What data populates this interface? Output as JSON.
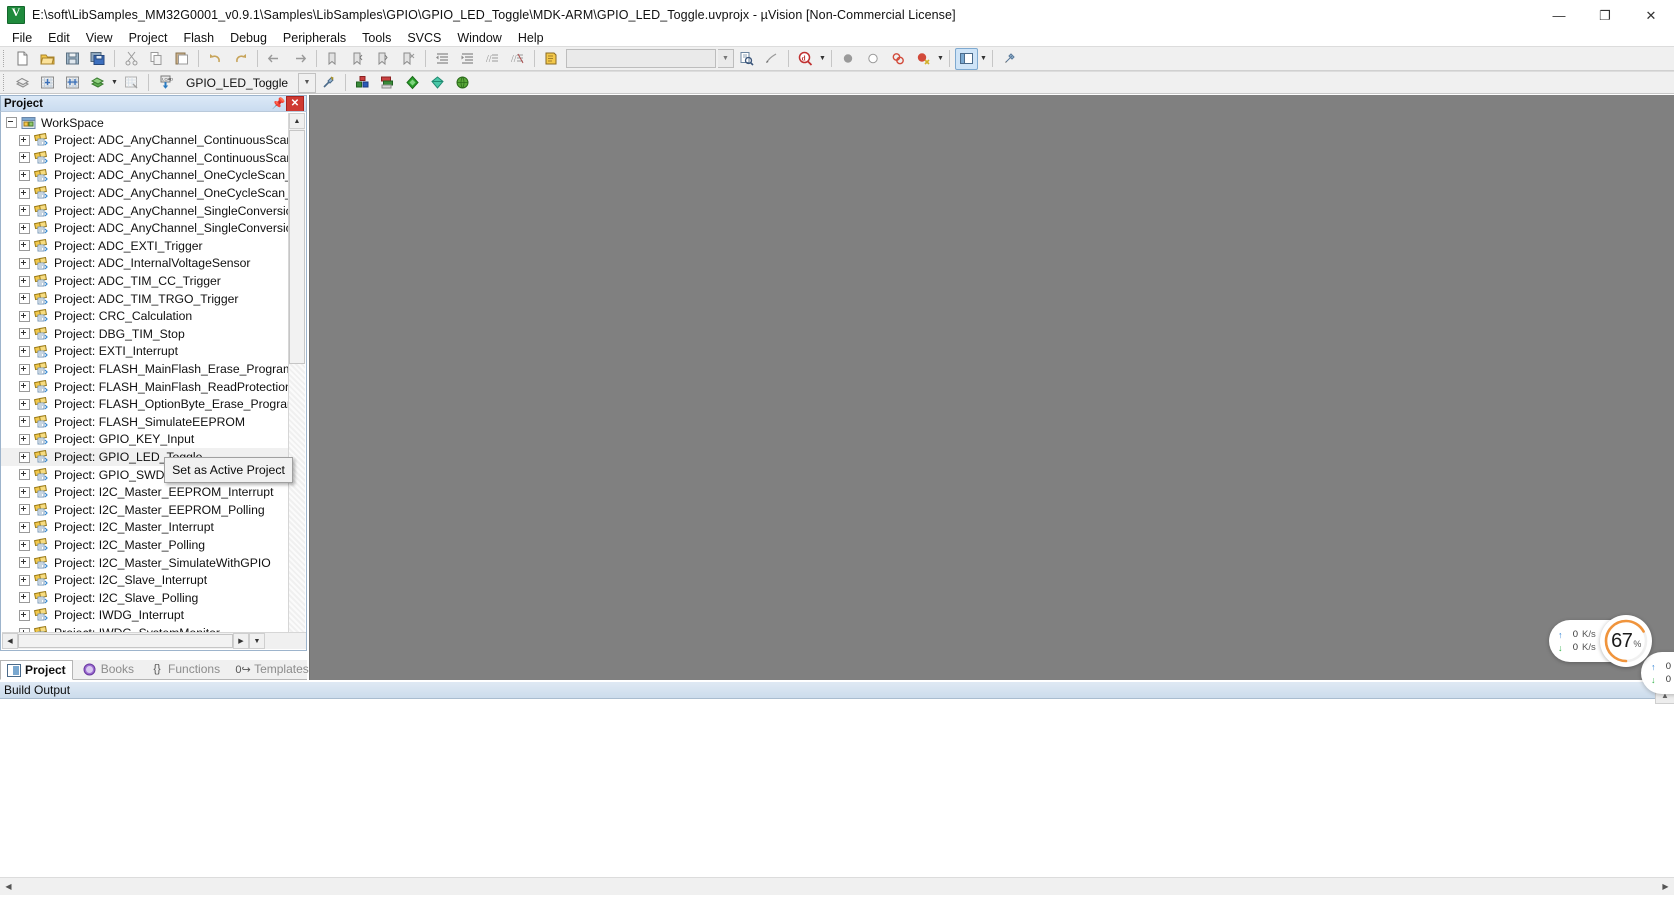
{
  "window": {
    "title": "E:\\soft\\LibSamples_MM32G0001_v0.9.1\\Samples\\LibSamples\\GPIO\\GPIO_LED_Toggle\\MDK-ARM\\GPIO_LED_Toggle.uvprojx - µVision  [Non-Commercial License]",
    "app_icon": "uvision-icon",
    "minimize": "—",
    "restore": "❐",
    "close": "✕"
  },
  "menubar": {
    "items": [
      {
        "label": "File"
      },
      {
        "label": "Edit"
      },
      {
        "label": "View"
      },
      {
        "label": "Project"
      },
      {
        "label": "Flash"
      },
      {
        "label": "Debug"
      },
      {
        "label": "Peripherals"
      },
      {
        "label": "Tools"
      },
      {
        "label": "SVCS"
      },
      {
        "label": "Window"
      },
      {
        "label": "Help"
      }
    ]
  },
  "toolbar_main": {
    "find_box_value": "",
    "find_box_placeholder": "",
    "buttons": [
      {
        "name": "new-file-icon",
        "tip": "New"
      },
      {
        "name": "open-file-icon",
        "tip": "Open"
      },
      {
        "name": "save-icon",
        "tip": "Save"
      },
      {
        "name": "save-all-icon",
        "tip": "Save All"
      },
      {
        "name": "cut-icon",
        "tip": "Cut"
      },
      {
        "name": "copy-icon",
        "tip": "Copy"
      },
      {
        "name": "paste-icon",
        "tip": "Paste"
      },
      {
        "name": "undo-icon",
        "tip": "Undo"
      },
      {
        "name": "redo-icon",
        "tip": "Redo"
      },
      {
        "name": "navigate-back-icon",
        "tip": "Back"
      },
      {
        "name": "navigate-forward-icon",
        "tip": "Forward"
      },
      {
        "name": "bookmark-toggle-icon",
        "tip": "Insert/Remove Bookmark"
      },
      {
        "name": "bookmark-prev-icon",
        "tip": "Previous Bookmark"
      },
      {
        "name": "bookmark-next-icon",
        "tip": "Next Bookmark"
      },
      {
        "name": "bookmark-clear-icon",
        "tip": "Clear Bookmarks"
      },
      {
        "name": "indent-icon",
        "tip": "Indent"
      },
      {
        "name": "outdent-icon",
        "tip": "Outdent"
      },
      {
        "name": "comment-icon",
        "tip": "Comment"
      },
      {
        "name": "uncomment-icon",
        "tip": "Uncomment"
      },
      {
        "name": "open-document-icon",
        "tip": "Open Document"
      },
      {
        "name": "find-in-files-icon",
        "tip": "Find in Files"
      },
      {
        "name": "incremental-find-icon",
        "tip": "Incremental Find"
      },
      {
        "name": "debug-session-icon",
        "tip": "Start/Stop Debug Session"
      },
      {
        "name": "breakpoint-icon",
        "tip": "Insert/Remove Breakpoint"
      },
      {
        "name": "disable-breakpoint-icon",
        "tip": "Disable Breakpoint"
      },
      {
        "name": "disable-all-breakpoints-icon",
        "tip": "Disable All Breakpoints"
      },
      {
        "name": "kill-all-breakpoints-icon",
        "tip": "Kill All Breakpoints"
      },
      {
        "name": "project-window-icon",
        "tip": "Project Window"
      }
    ]
  },
  "toolbar_build": {
    "project_name": "GPIO_LED_Toggle",
    "buttons": [
      {
        "name": "translate-icon",
        "tip": "Translate"
      },
      {
        "name": "build-icon",
        "tip": "Build"
      },
      {
        "name": "rebuild-icon",
        "tip": "Rebuild"
      },
      {
        "name": "batch-build-icon",
        "tip": "Batch Build"
      },
      {
        "name": "stop-build-icon",
        "tip": "Stop Build"
      },
      {
        "name": "download-icon",
        "tip": "Download"
      },
      {
        "name": "target-options-icon",
        "tip": "Options for Target"
      },
      {
        "name": "manage-project-items-icon",
        "tip": "Manage Project Items"
      },
      {
        "name": "manage-run-time-env-icon",
        "tip": "Manage Run-Time Environment"
      },
      {
        "name": "select-software-packs-icon",
        "tip": "Select Software Packs"
      },
      {
        "name": "pack-installer-icon",
        "tip": "Pack Installer"
      }
    ]
  },
  "project_panel": {
    "title": "Project",
    "pin_icon": "pin-icon",
    "close_icon": "close-icon",
    "root": {
      "label": "WorkSpace",
      "icon": "workspace-icon"
    },
    "items": [
      {
        "label": "Project: ADC_AnyChannel_ContinuousScan_Interrupt"
      },
      {
        "label": "Project: ADC_AnyChannel_ContinuousScan_Polling"
      },
      {
        "label": "Project: ADC_AnyChannel_OneCycleScan_Interrupt"
      },
      {
        "label": "Project: ADC_AnyChannel_OneCycleScan_Polling"
      },
      {
        "label": "Project: ADC_AnyChannel_SingleConversion_Interrupt"
      },
      {
        "label": "Project: ADC_AnyChannel_SingleConversion_Polling"
      },
      {
        "label": "Project: ADC_EXTI_Trigger"
      },
      {
        "label": "Project: ADC_InternalVoltageSensor"
      },
      {
        "label": "Project: ADC_TIM_CC_Trigger"
      },
      {
        "label": "Project: ADC_TIM_TRGO_Trigger"
      },
      {
        "label": "Project: CRC_Calculation"
      },
      {
        "label": "Project: DBG_TIM_Stop"
      },
      {
        "label": "Project: EXTI_Interrupt"
      },
      {
        "label": "Project: FLASH_MainFlash_Erase_Program"
      },
      {
        "label": "Project: FLASH_MainFlash_ReadProtection"
      },
      {
        "label": "Project: FLASH_OptionByte_Erase_Program"
      },
      {
        "label": "Project: FLASH_SimulateEEPROM"
      },
      {
        "label": "Project: GPIO_KEY_Input"
      },
      {
        "label": "Project: GPIO_LED_Toggle",
        "selected": true
      },
      {
        "label": "Project: GPIO_SWD_Port"
      },
      {
        "label": "Project: I2C_Master_EEPROM_Interrupt"
      },
      {
        "label": "Project: I2C_Master_EEPROM_Polling"
      },
      {
        "label": "Project: I2C_Master_Interrupt"
      },
      {
        "label": "Project: I2C_Master_Polling"
      },
      {
        "label": "Project: I2C_Master_SimulateWithGPIO"
      },
      {
        "label": "Project: I2C_Slave_Interrupt"
      },
      {
        "label": "Project: I2C_Slave_Polling"
      },
      {
        "label": "Project: IWDG_Interrupt"
      },
      {
        "label": "Project: IWDG_SystemMonitor"
      }
    ]
  },
  "context_menu": {
    "items": [
      {
        "label": "Set as Active Project"
      }
    ]
  },
  "panel_tabs": [
    {
      "label": "Project",
      "icon": "project-tab-icon",
      "active": true
    },
    {
      "label": "Books",
      "icon": "books-tab-icon",
      "active": false
    },
    {
      "label": "Functions",
      "icon": "functions-tab-icon",
      "active": false
    },
    {
      "label": "Templates",
      "icon": "templates-tab-icon",
      "active": false
    }
  ],
  "build_output": {
    "title": "Build Output",
    "content": ""
  },
  "overlay": {
    "net_upload_arrow": "↑",
    "net_upload_value": "0",
    "net_upload_unit": "K/s",
    "net_download_arrow": "↓",
    "net_download_value": "0",
    "net_download_unit": "K/s",
    "cpu_value": "67",
    "cpu_unit": "%",
    "accent_color": "#f0943c"
  }
}
